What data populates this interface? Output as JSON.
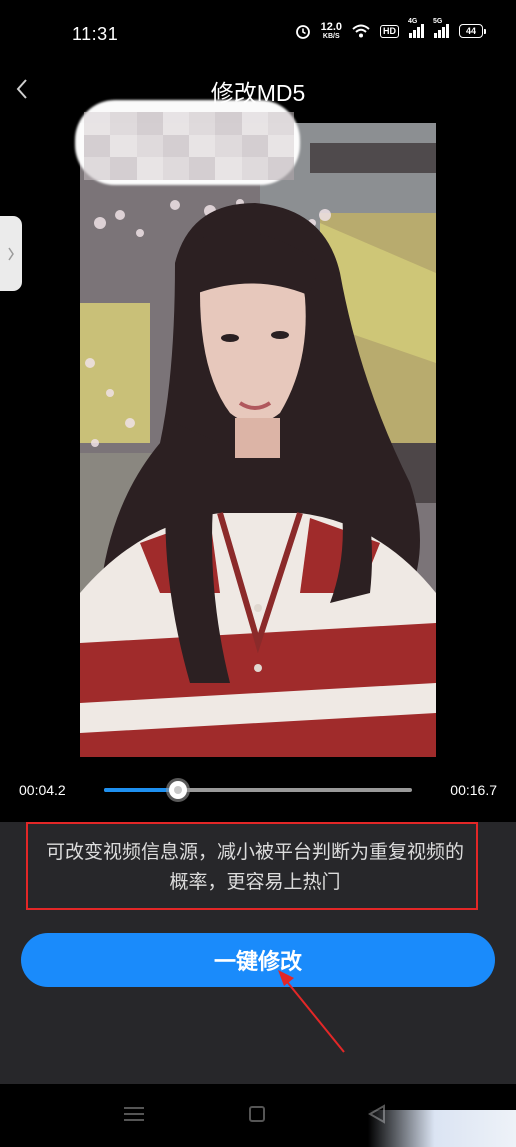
{
  "status_bar": {
    "time": "11:31",
    "net_speed_value": "12.0",
    "net_speed_unit": "KB/S",
    "hd_badge": "HD",
    "signal_1_label": "4G",
    "signal_2_label": "5G",
    "battery_level": "44"
  },
  "header": {
    "title": "修改MD5",
    "back_icon": "chevron-left-icon"
  },
  "player": {
    "current_time": "00:04.2",
    "total_time": "00:16.7",
    "progress": 0.24
  },
  "description": "可改变视频信息源，减小被平台判断为重复视频的概率，更容易上热门",
  "primary_button": "一键修改",
  "nav": {
    "icons": [
      "menu-icon",
      "home-square-icon",
      "back-triangle-icon"
    ]
  },
  "colors": {
    "accent": "#1a8bfb",
    "highlight_border": "#e32727",
    "panel_bg": "#27272a",
    "background": "#000000"
  }
}
